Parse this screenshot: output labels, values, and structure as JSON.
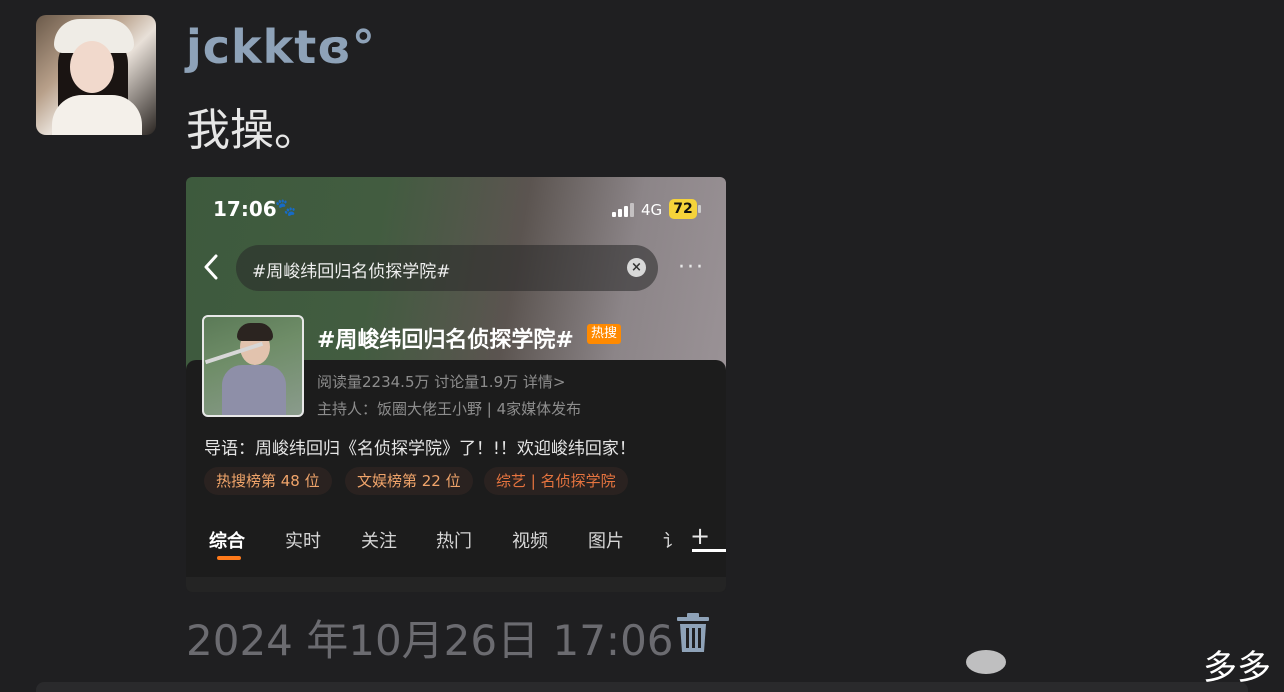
{
  "post": {
    "username": "jckktɞ°",
    "message": "我操。",
    "timestamp": "2024 年10月26日 17:06"
  },
  "screenshot": {
    "status": {
      "time": "17:06",
      "network": "4G",
      "battery": "72"
    },
    "search": {
      "query": "#周峻纬回归名侦探学院#",
      "more": "···"
    },
    "topic": {
      "title": "#周峻纬回归名侦探学院#",
      "badge": "热搜",
      "stats": "阅读量2234.5万  讨论量1.9万  详情>",
      "host": "主持人：饭圈大佬王小野 | 4家媒体发布",
      "intro": "导语：周峻纬回归《名侦探学院》了！!！欢迎峻纬回家！",
      "tags": [
        "热搜榜第 48 位",
        "文娱榜第 22 位",
        "综艺 | 名侦探学院"
      ]
    },
    "tabs": [
      "综合",
      "实时",
      "关注",
      "热门",
      "视频",
      "图片",
      "讠"
    ],
    "tab_plus": "+"
  },
  "watermark": "_多多",
  "icons": [
    "paw-icon",
    "signal-icon",
    "back-icon",
    "clear-icon",
    "more-icon",
    "trash-icon",
    "watermark-logo"
  ]
}
